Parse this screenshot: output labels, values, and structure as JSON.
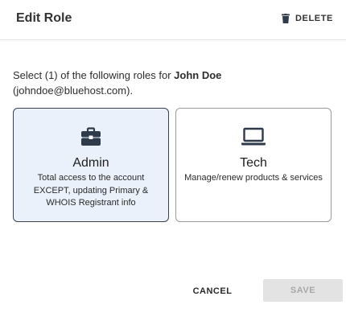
{
  "dialog": {
    "title": "Edit Role",
    "delete_label": "DELETE"
  },
  "instructions": {
    "prefix": "Select (1) of the following roles for ",
    "user_name": "John Doe",
    "user_email": "(johndoe@bluehost.com)."
  },
  "roles": [
    {
      "name": "Admin",
      "icon": "briefcase-icon",
      "description": "Total access to the account EXCEPT, updating Primary & WHOIS Registrant info",
      "selected": true
    },
    {
      "name": "Tech",
      "icon": "laptop-icon",
      "description": "Manage/renew products & services",
      "selected": false
    }
  ],
  "actions": {
    "cancel_label": "CANCEL",
    "save_label": "SAVE",
    "save_disabled": true
  },
  "colors": {
    "selected_card_bg": "#eaf1fb",
    "selected_card_border": "#3b4151",
    "icon_color": "#2f3a4b",
    "disabled_button_bg": "#e3e3e3"
  }
}
